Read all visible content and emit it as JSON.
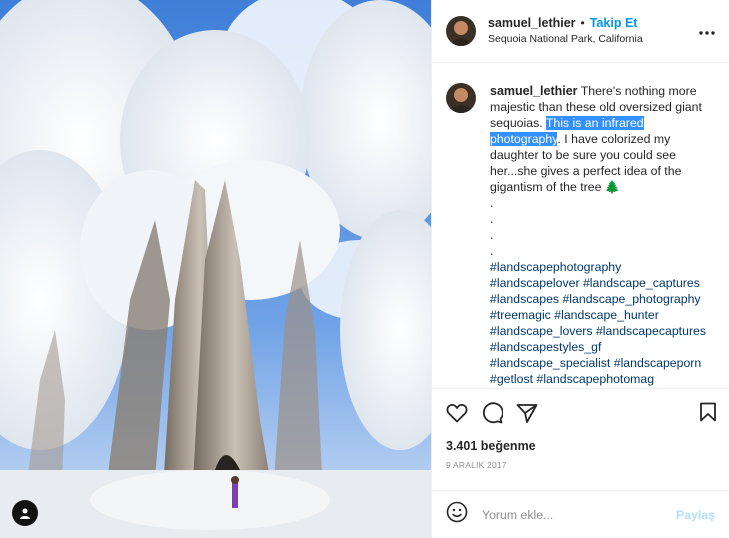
{
  "post": {
    "username": "samuel_lethier",
    "separator": "•",
    "follow_label": "Takip Et",
    "location": "Sequoia National Park, California",
    "more_icon": "more-horizontal-icon"
  },
  "caption": {
    "username": "samuel_lethier",
    "text_before": " There's nothing more majestic than these old oversized giant sequoias. ",
    "highlighted": "This is an infrared photography",
    "text_after": ". I have colorized my daughter to be sure you could see her...she gives a perfect idea of the gigantism of the tree 🌲",
    "dots": [
      ".",
      ".",
      ".",
      "."
    ],
    "hashtags": [
      "#landscapephotography",
      "#landscapelover #landscape_captures",
      "#landscapes #landscape_photography",
      "#treemagic #landscape_hunter",
      "#landscape_lovers #landscapecaptures",
      "#landscapestyles_gf",
      "#landscape_specialist #landscapeporn",
      "#getlost #landscapephotomag"
    ]
  },
  "actions": {
    "icons": [
      "heart-icon",
      "comment-icon",
      "share-icon",
      "bookmark-icon"
    ]
  },
  "likes": "3.401 beğenme",
  "date": "9 ARALIK 2017",
  "comment_box": {
    "placeholder": "Yorum ekle...",
    "share_label": "Paylaş"
  },
  "colors": {
    "link": "#0095f6",
    "hashtag": "#00376b",
    "highlight": "#3390ff",
    "sky": "#2f6fd1"
  }
}
